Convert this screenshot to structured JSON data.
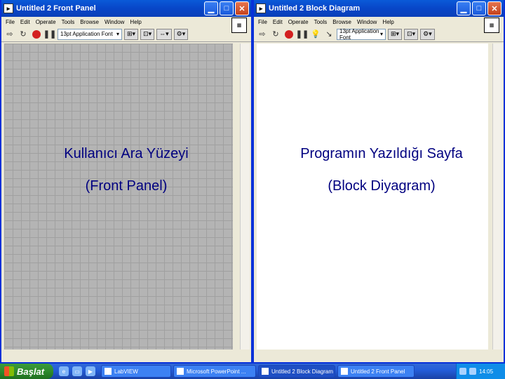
{
  "front_panel": {
    "title": "Untitled 2 Front Panel",
    "menu": [
      "File",
      "Edit",
      "Operate",
      "Tools",
      "Browse",
      "Window",
      "Help"
    ],
    "font": "13pt Application Font",
    "caption_line1": "Kullanıcı Ara Yüzeyi",
    "caption_line2": "(Front Panel)"
  },
  "block_diagram": {
    "title": "Untitled 2 Block Diagram",
    "menu": [
      "File",
      "Edit",
      "Operate",
      "Tools",
      "Browse",
      "Window",
      "Help"
    ],
    "font": "13pt Application Font",
    "caption_line1": "Programın Yazıldığı Sayfa",
    "caption_line2": "(Block Diyagram)"
  },
  "taskbar": {
    "start_label": "Başlat",
    "tasks": [
      "LabVIEW",
      "Microsoft PowerPoint ...",
      "Untitled 2 Block Diagram",
      "Untitled 2 Front Panel"
    ],
    "clock": "14:05"
  },
  "icons": {
    "minimize": "minimize-icon",
    "maximize": "maximize-icon",
    "close": "close-icon"
  }
}
